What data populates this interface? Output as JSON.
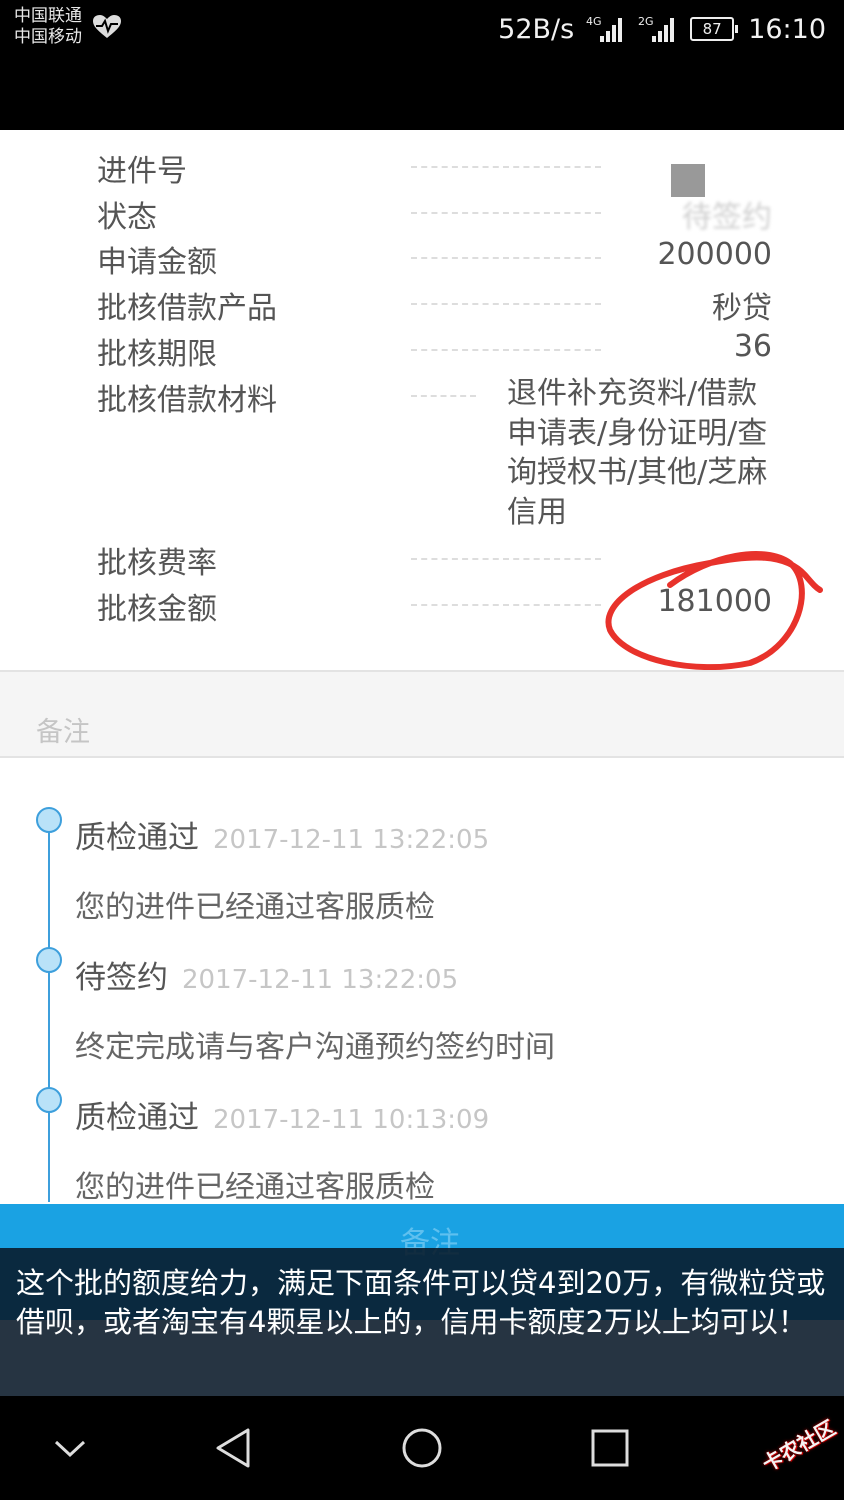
{
  "status_bar": {
    "carrier_1": "中国联通",
    "carrier_2": "中国移动",
    "net_speed": "52B/s",
    "signal_1": "4G",
    "signal_2": "2G",
    "battery": "87",
    "time": "16:10"
  },
  "details": {
    "rows": [
      {
        "label": "进件号",
        "value": ""
      },
      {
        "label": "状态",
        "value": "待签约"
      },
      {
        "label": "申请金额",
        "value": "200000"
      },
      {
        "label": "批核借款产品",
        "value": "秒贷"
      },
      {
        "label": "批核期限",
        "value": "36"
      },
      {
        "label": "批核借款材料",
        "value": "退件补充资料/借款申请表/身份证明/查询授权书/其他/芝麻信用"
      },
      {
        "label": "批核费率",
        "value": ""
      },
      {
        "label": "批核金额",
        "value": "181000"
      }
    ]
  },
  "remarks": {
    "title": "备注"
  },
  "timeline": [
    {
      "title": "质检通过",
      "time": "2017-12-11 13:22:05",
      "desc": "您的进件已经通过客服质检"
    },
    {
      "title": "待签约",
      "time": "2017-12-11 13:22:05",
      "desc": "终定完成请与客户沟通预约签约时间"
    },
    {
      "title": "质检通过",
      "time": "2017-12-11 10:13:09",
      "desc": "您的进件已经通过客服质检"
    }
  ],
  "bottom_bar": {
    "label": "备注"
  },
  "caption": "这个批的额度给力，满足下面条件可以贷4到20万，有微粒贷或借呗，或者淘宝有4颗星以上的，信用卡额度2万以上均可以！",
  "watermark": "卡农社区",
  "colors": {
    "accent_blue": "#1aa2e3",
    "timeline_blue": "#3d9fdc",
    "annotation_red": "#e8322b"
  },
  "icons": [
    "heart-icon",
    "signal-icon",
    "battery-icon",
    "back-icon",
    "home-icon",
    "recents-icon",
    "chevron-down-icon"
  ]
}
